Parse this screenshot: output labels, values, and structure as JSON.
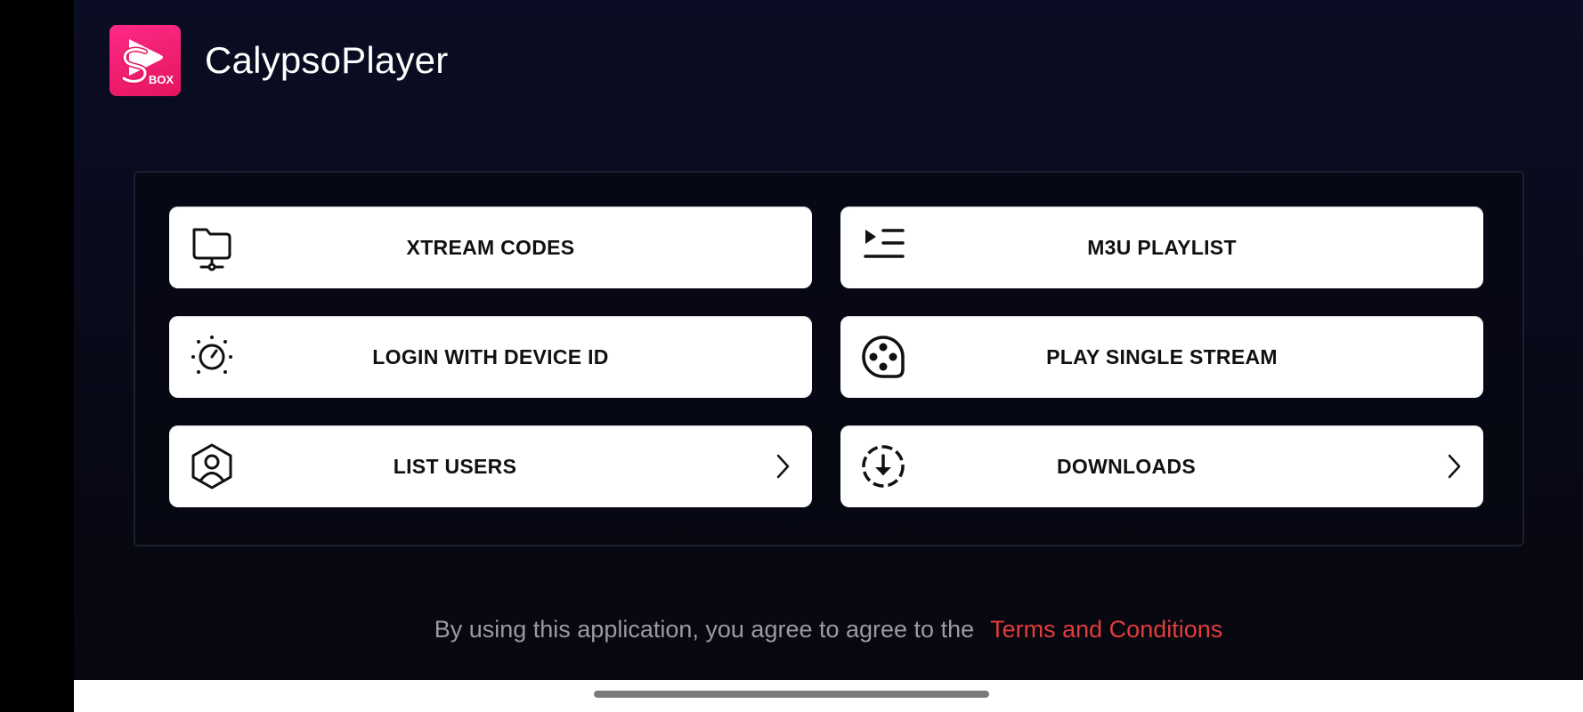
{
  "app": {
    "title": "CalypsoPlayer",
    "logo_text": "BOX"
  },
  "menu": [
    {
      "label": "XTREAM CODES",
      "icon": "folder-network-icon",
      "chevron": false
    },
    {
      "label": "M3U PLAYLIST",
      "icon": "playlist-icon",
      "chevron": false
    },
    {
      "label": "LOGIN WITH DEVICE ID",
      "icon": "device-gauge-icon",
      "chevron": false
    },
    {
      "label": "PLAY SINGLE STREAM",
      "icon": "film-reel-icon",
      "chevron": false
    },
    {
      "label": "LIST USERS",
      "icon": "user-hexagon-icon",
      "chevron": true
    },
    {
      "label": "DOWNLOADS",
      "icon": "download-circle-icon",
      "chevron": true
    }
  ],
  "footer": {
    "text": "By using this application, you agree to agree to the",
    "link": "Terms and Conditions"
  },
  "colors": {
    "accent": "#e53b3b",
    "logo": "#ec1c6c",
    "background": "#0a0b1e"
  }
}
